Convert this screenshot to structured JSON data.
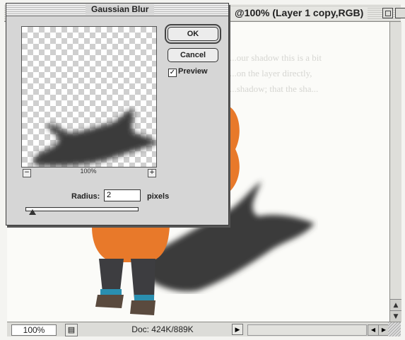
{
  "document": {
    "title": "@100% (Layer 1 copy,RGB)",
    "ghost_lines": [
      "...our shadow this is a bit",
      "...on the layer directly,",
      "...shadow; that the sha..."
    ]
  },
  "status_bar": {
    "zoom": "100%",
    "doc_info": "Doc: 424K/889K"
  },
  "dialog": {
    "title": "Gaussian Blur",
    "ok_label": "OK",
    "cancel_label": "Cancel",
    "preview_label": "Preview",
    "preview_checked": true,
    "preview_zoom": "100%",
    "radius_label": "Radius:",
    "radius_value": "2",
    "radius_units": "pixels",
    "radius_slider_fraction": 0.06
  },
  "colors": {
    "accent_orange": "#e8792a",
    "shadow": "#3a3a3a"
  }
}
